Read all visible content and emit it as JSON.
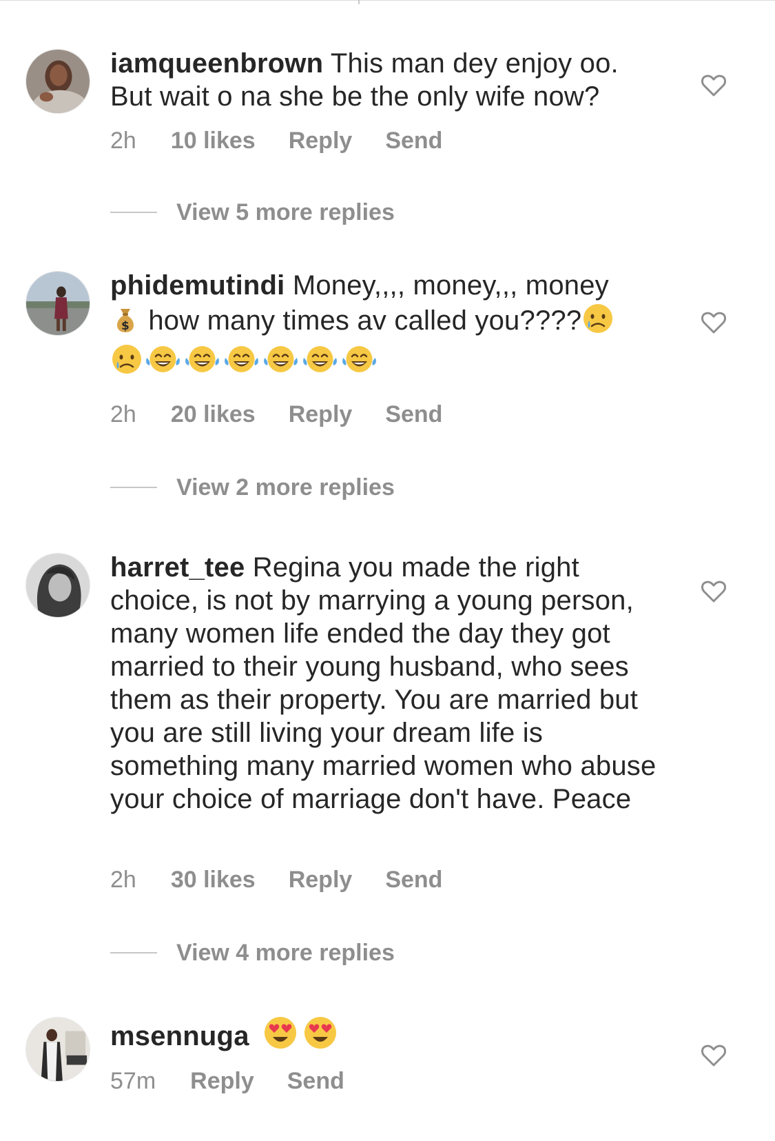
{
  "comments": [
    {
      "username": "iamqueenbrown",
      "text": "This man dey enjoy oo. But wait o na she be the only wife now?",
      "time": "2h",
      "likes": "10 likes",
      "reply": "Reply",
      "send": "Send",
      "view_more": "View 5 more replies"
    },
    {
      "username": "phidemutindi",
      "text_before": "Money,,,, money,,, money",
      "text_after": "how many times av called you????",
      "time": "2h",
      "likes": "20 likes",
      "reply": "Reply",
      "send": "Send",
      "view_more": "View 2 more replies"
    },
    {
      "username": "harret_tee",
      "text": "Regina you made the right choice, is not by marrying a young person, many women life ended the day they got married to their young husband, who sees them as their property. You are married but you are still living your dream life is something many married women who abuse your choice of marriage don't have. Peace",
      "time": "2h",
      "likes": "30 likes",
      "reply": "Reply",
      "send": "Send",
      "view_more": "View 4 more replies"
    },
    {
      "username": "msennuga",
      "time": "57m",
      "reply": "Reply",
      "send": "Send"
    }
  ],
  "icons": {
    "like": "heart-outline-icon",
    "money_bag": "money-bag-emoji",
    "crying": "crying-face-emoji",
    "laughing": "tears-of-joy-emoji",
    "heart_eyes": "heart-eyes-emoji"
  },
  "colors": {
    "text": "#262626",
    "secondary": "#8e8e8e",
    "divider": "#c7c7c7"
  }
}
